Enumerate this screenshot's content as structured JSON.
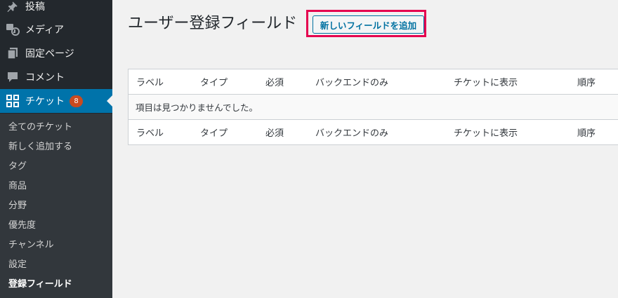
{
  "sidebar": {
    "items": [
      {
        "label": "投稿",
        "icon": "pin-icon"
      },
      {
        "label": "メディア",
        "icon": "media-icon"
      },
      {
        "label": "固定ページ",
        "icon": "pages-icon"
      },
      {
        "label": "コメント",
        "icon": "comment-icon"
      },
      {
        "label": "チケット",
        "icon": "grid-icon",
        "badge": "8",
        "active": true
      }
    ],
    "submenu": [
      {
        "label": "全てのチケット"
      },
      {
        "label": "新しく追加する"
      },
      {
        "label": "タグ"
      },
      {
        "label": "商品"
      },
      {
        "label": "分野"
      },
      {
        "label": "優先度"
      },
      {
        "label": "チャンネル"
      },
      {
        "label": "設定"
      },
      {
        "label": "登録フィールド",
        "current": true
      }
    ]
  },
  "main": {
    "title": "ユーザー登録フィールド",
    "add_button": "新しいフィールドを追加",
    "columns": [
      "ラベル",
      "タイプ",
      "必須",
      "バックエンドのみ",
      "チケットに表示",
      "順序"
    ],
    "empty_message": "項目は見つかりませんでした。"
  },
  "colors": {
    "sidebar_bg": "#23282d",
    "submenu_bg": "#32373c",
    "active_bg": "#0073aa",
    "highlight": "#e5004f",
    "badge": "#ca4a1f"
  }
}
